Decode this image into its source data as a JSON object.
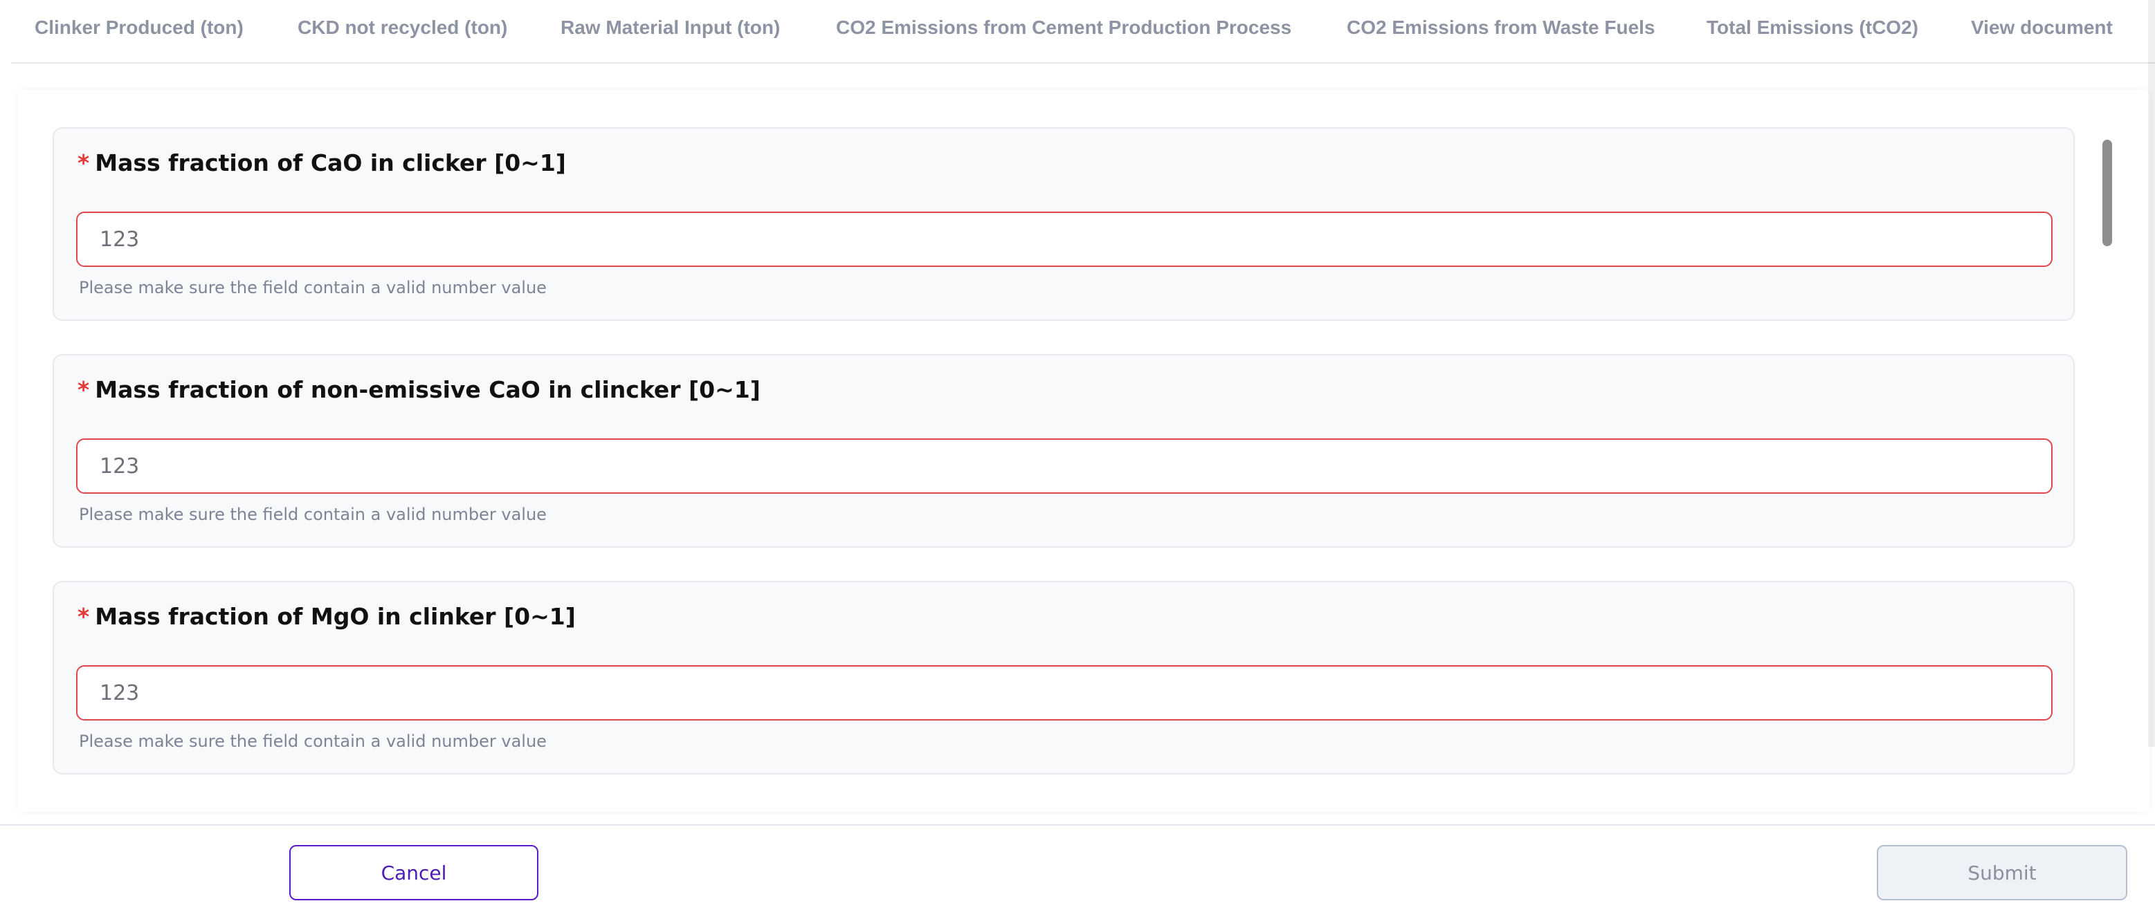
{
  "tabs": [
    {
      "label": "Clinker Produced (ton)"
    },
    {
      "label": "CKD not recycled (ton)"
    },
    {
      "label": "Raw Material Input (ton)"
    },
    {
      "label": "CO2 Emissions from Cement Production Process"
    },
    {
      "label": "CO2 Emissions from Waste Fuels"
    },
    {
      "label": "Total Emissions (tCO2)"
    },
    {
      "label": "View document"
    }
  ],
  "fields": [
    {
      "required_mark": "*",
      "label": "Mass fraction of CaO in clicker [0~1]",
      "value": "123",
      "error": "Please make sure the field contain a valid number value"
    },
    {
      "required_mark": "*",
      "label": "Mass fraction of non-emissive CaO in clincker [0~1]",
      "value": "123",
      "error": "Please make sure the field contain a valid number value"
    },
    {
      "required_mark": "*",
      "label": "Mass fraction of MgO in clinker [0~1]",
      "value": "123",
      "error": "Please make sure the field contain a valid number value"
    }
  ],
  "footer": {
    "cancel_label": "Cancel",
    "submit_label": "Submit"
  },
  "colors": {
    "accent": "#4a1bb8",
    "error_border": "#e0474b",
    "required": "#e53935",
    "tab_text": "#8d93a3"
  }
}
